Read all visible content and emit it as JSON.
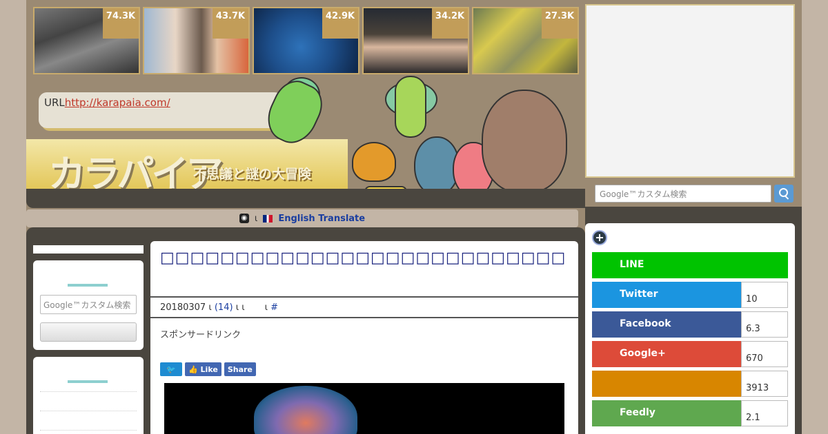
{
  "thumbnails": [
    {
      "count": "74.3K"
    },
    {
      "count": "43.7K"
    },
    {
      "count": "42.9K"
    },
    {
      "count": "34.2K"
    },
    {
      "count": "27.3K"
    }
  ],
  "url_box": {
    "label": "URL",
    "link": "http://karapaia.com/"
  },
  "logo": {
    "text": "カラパイア",
    "tagline": "不思議と謎の大冒険"
  },
  "translate": {
    "separator": "ι",
    "label": "English Translate"
  },
  "search": {
    "placeholder": "Google™カスタム検索"
  },
  "article": {
    "title": "□□□□□□□□□□□□□□□□□□□□□□□□□□□□□□□□□□□□□□□□□□□□□□□□□",
    "meta_date": "20180307",
    "meta_sep1": "ι",
    "meta_comments": "(14)",
    "meta_sep2": "ι ι",
    "meta_sep3": "ι",
    "meta_hash": "#",
    "sponsored": "スポンサードリンク",
    "like_label": "Like",
    "share_label": "Share"
  },
  "share_panel": [
    {
      "label": "LINE",
      "count": "",
      "color": "#00c300"
    },
    {
      "label": "Twitter",
      "count": "10",
      "color": "#1b95e0"
    },
    {
      "label": "Facebook",
      "count": "6.3",
      "color": "#3b5998"
    },
    {
      "label": "Google+",
      "count": "670",
      "color": "#dd4b39"
    },
    {
      "label": "",
      "count": "3913",
      "color": "#d88600"
    },
    {
      "label": "Feedly",
      "count": "2.1",
      "color": "#5fa84f"
    }
  ]
}
